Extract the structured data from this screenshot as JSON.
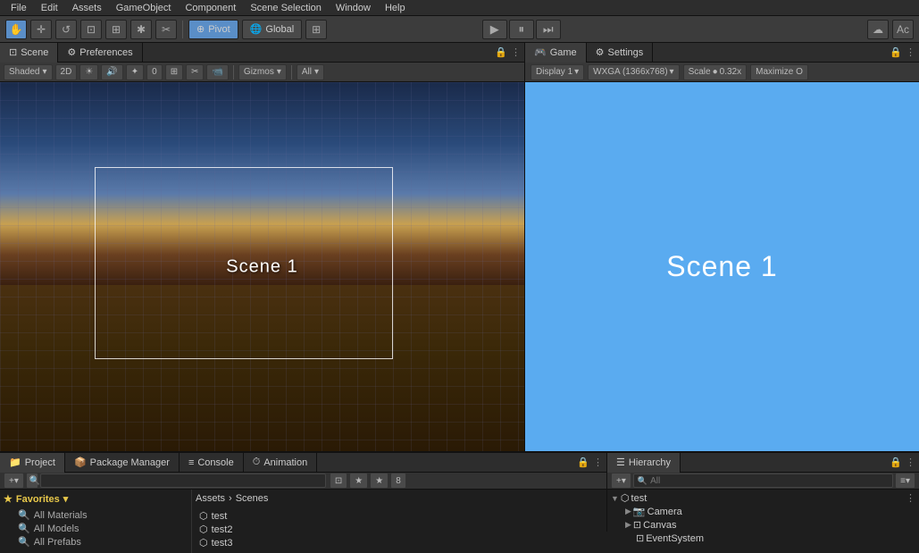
{
  "menuBar": {
    "items": [
      "File",
      "Edit",
      "Assets",
      "GameObject",
      "Component",
      "Scene Selection",
      "Window",
      "Help"
    ]
  },
  "toolbar": {
    "tools": [
      "✋",
      "↔",
      "↺",
      "⊡",
      "⊞",
      "✱",
      "✂"
    ],
    "pivot": "Pivot",
    "global": "Global",
    "pivot_icon": "⊕",
    "play": "▶",
    "pause": "⏸",
    "step": "⏭",
    "cloud": "☁",
    "account": "Ac"
  },
  "scenePanel": {
    "tabs": [
      "Scene",
      "Preferences"
    ],
    "sceneTab": "Scene",
    "preferencesTab": "Preferences",
    "shadingMode": "Shaded",
    "shadingDropdown": "▾",
    "twoDMode": "2D",
    "gizmos": "Gizmos",
    "all": "All",
    "sceneLabel": "Scene 1"
  },
  "gamePanel": {
    "tabs": [
      "Game",
      "Settings"
    ],
    "gameTab": "Game",
    "settingsTab": "Settings",
    "display": "Display 1",
    "resolution": "WXGA (1366x768)",
    "scale": "Scale",
    "scaleValue": "0.32x",
    "maximize": "Maximize O",
    "gameLabel": "Scene 1"
  },
  "bottomTabs": {
    "project": "Project",
    "packageManager": "Package Manager",
    "console": "Console",
    "animation": "Animation"
  },
  "favorites": {
    "header": "Favorites",
    "items": [
      "All Materials",
      "All Models",
      "All Prefabs"
    ]
  },
  "assets": {
    "breadcrumb": [
      "Assets",
      "Scenes"
    ],
    "items": [
      "test",
      "test2",
      "test3"
    ]
  },
  "hierarchy": {
    "tab": "Hierarchy",
    "rootItem": "test",
    "children": [
      "Camera",
      "Canvas",
      "EventSystem"
    ]
  },
  "icons": {
    "star": "★",
    "lock": "🔒",
    "more": "⋮",
    "search": "🔍",
    "add": "+",
    "folder": "📁",
    "scene": "⬡",
    "arrow_right": "▶",
    "arrow_down": "▼"
  }
}
